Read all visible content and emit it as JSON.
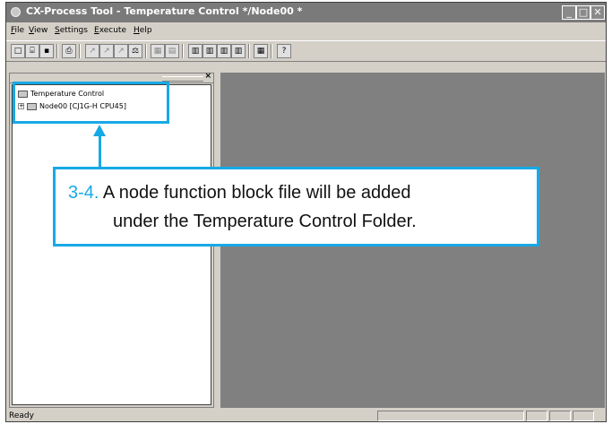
{
  "window": {
    "title": "CX-Process Tool - Temperature Control */Node00 *"
  },
  "menu": [
    "File",
    "View",
    "Settings",
    "Execute",
    "Help"
  ],
  "toolbar": {
    "icons": [
      "new-icon",
      "open-icon",
      "save-icon",
      "print-icon",
      "draw-line-icon",
      "arrow-icon",
      "arrow2-icon",
      "scale-icon",
      "rh-icon",
      "run-stop-icon",
      "grid1-icon",
      "grid2-icon",
      "grid3-icon",
      "grid4-icon",
      "table-icon",
      "help-icon"
    ]
  },
  "tree": {
    "root": "Temperature Control",
    "node": "Node00 [CJ1G-H CPU45]"
  },
  "callout": {
    "number": "3-4.",
    "line1": "A node function block file will be added",
    "line2": "under the Temperature Control Folder."
  },
  "status": {
    "text": "Ready"
  },
  "colors": {
    "accent": "#17a9e6",
    "workarea": "#808080",
    "chrome": "#d4d0c8",
    "titlebar": "#7a7a7a"
  }
}
